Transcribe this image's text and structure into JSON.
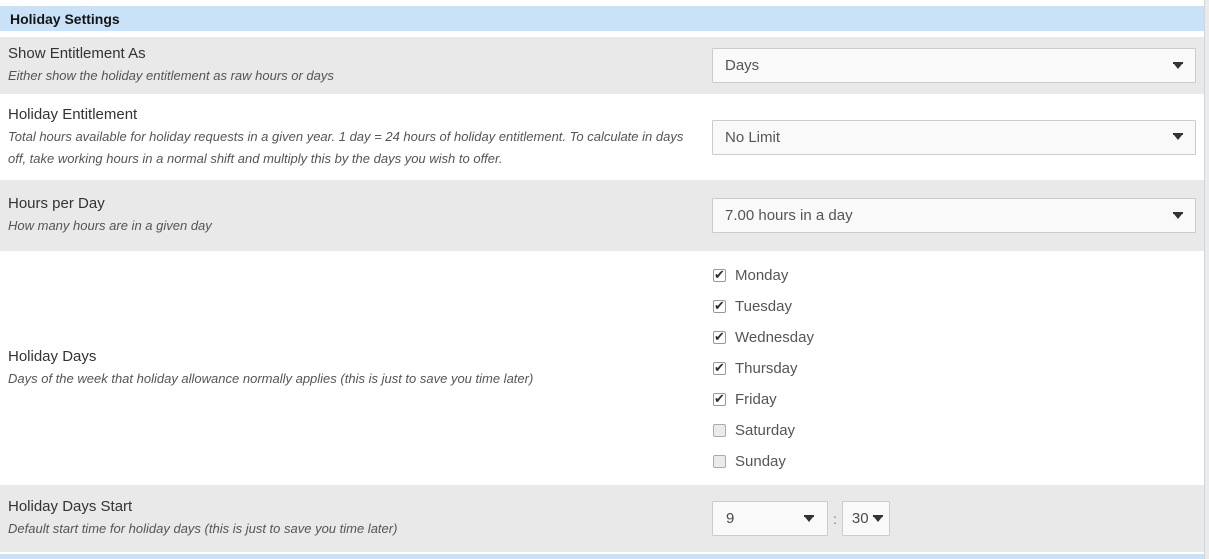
{
  "panel": {
    "title": "Holiday Settings"
  },
  "colors": {
    "panel-heading-bg": "#c9e2f7",
    "row-alt-bg": "#e9e9e9",
    "control-bg": "#f9f9f9",
    "control-border": "#cccccc",
    "label-color": "#333333",
    "desc-color": "#555555",
    "value-color": "#555555"
  },
  "settings": [
    {
      "id": "show-entitlement-as",
      "label": "Show Entitlement As",
      "description": "Either show the holiday entitlement as raw hours or days",
      "control": {
        "type": "select",
        "value": "Days",
        "caret_icon": "chevron-down-icon"
      }
    },
    {
      "id": "holiday-entitlement",
      "label": "Holiday Entitlement",
      "description": "Total hours available for holiday requests in a given year. 1 day = 24 hours of holiday entitlement. To calculate in days off, take working hours in a normal shift and multiply this by the days you wish to offer.",
      "control": {
        "type": "select",
        "value": "No Limit",
        "caret_icon": "chevron-down-icon"
      }
    },
    {
      "id": "hours-per-day",
      "label": "Hours per Day",
      "description": "How many hours are in a given day",
      "control": {
        "type": "select",
        "value": "7.00 hours in a day",
        "caret_icon": "chevron-down-icon"
      }
    },
    {
      "id": "holiday-days",
      "label": "Holiday Days",
      "description": "Days of the week that holiday allowance normally applies (this is just to save you time later)",
      "control": {
        "type": "checkbox-list",
        "options": [
          {
            "label": "Monday",
            "checked": true
          },
          {
            "label": "Tuesday",
            "checked": true
          },
          {
            "label": "Wednesday",
            "checked": true
          },
          {
            "label": "Thursday",
            "checked": true
          },
          {
            "label": "Friday",
            "checked": true
          },
          {
            "label": "Saturday",
            "checked": false
          },
          {
            "label": "Sunday",
            "checked": false
          }
        ]
      }
    },
    {
      "id": "holiday-days-start",
      "label": "Holiday Days Start",
      "description": "Default start time for holiday days (this is just to save you time later)",
      "control": {
        "type": "time",
        "hour": "9",
        "separator": ":",
        "minute": "30"
      }
    }
  ]
}
